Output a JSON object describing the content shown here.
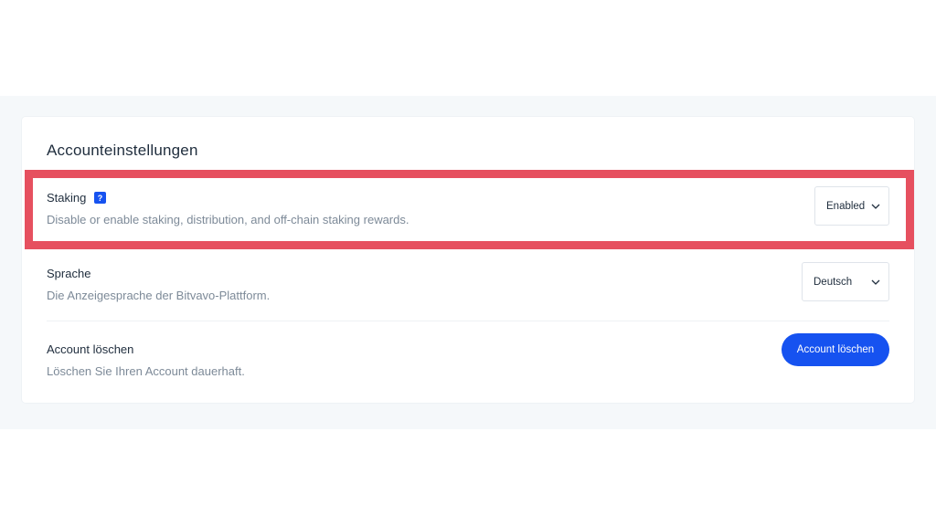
{
  "section": {
    "title": "Accounteinstellungen"
  },
  "staking": {
    "title": "Staking",
    "help_icon": "question-mark-icon",
    "help_glyph": "?",
    "description": "Disable or enable staking, distribution, and off-chain staking rewards.",
    "select_value": "Enabled"
  },
  "language": {
    "title": "Sprache",
    "description": "Die Anzeigesprache der Bitvavo-Plattform.",
    "select_value": "Deutsch"
  },
  "delete_account": {
    "title": "Account löschen",
    "description": "Löschen Sie Ihren Account dauerhaft.",
    "button_label": "Account löschen"
  },
  "colors": {
    "accent": "#1652f0",
    "highlight": "#e6505f"
  }
}
